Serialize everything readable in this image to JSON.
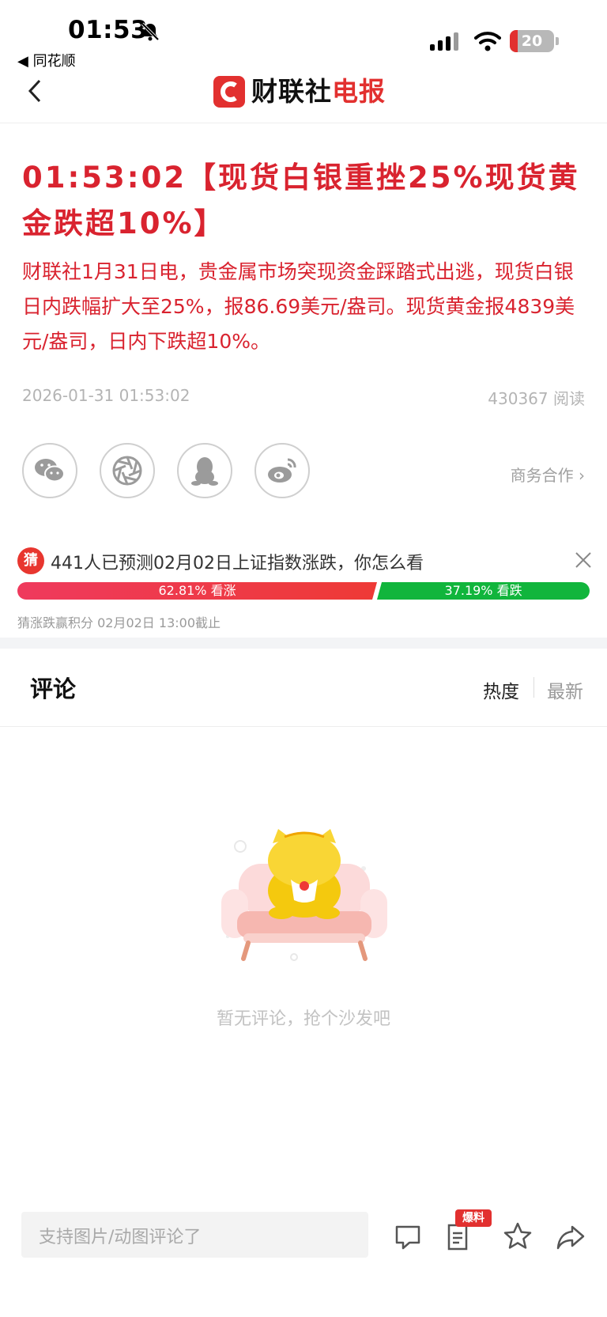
{
  "status_bar": {
    "time": "01:53",
    "back_app": "◀ 同花顺",
    "battery": "20"
  },
  "nav": {
    "logo_black": "财联社",
    "logo_red": "电报"
  },
  "article": {
    "headline": "01:53:02【现货白银重挫25%现货黄金跌超10%】",
    "body": "财联社1月31日电，贵金属市场突现资金踩踏式出逃，现货白银日内跌幅扩大至25%，报86.69美元/盎司。现货黄金报4839美元/盎司，日内下跌超10%。",
    "datetime": "2026-01-31 01:53:02",
    "reads": "430367 阅读",
    "business": "商务合作 ›"
  },
  "share_icons": [
    "wechat-icon",
    "moments-icon",
    "qq-icon",
    "weibo-icon"
  ],
  "poll": {
    "badge": "猜",
    "question": "441人已预测02月02日上证指数涨跌，你怎么看",
    "up_label": "62.81% 看涨",
    "down_label": "37.19% 看跌",
    "up_fraction": 0.6281,
    "down_fraction": 0.3719,
    "footer": "猜涨跌赢积分   02月02日 13:00截止"
  },
  "comments": {
    "title": "评论",
    "sort_hot": "热度",
    "sort_new": "最新",
    "empty_text": "暂无评论，抢个沙发吧"
  },
  "bottom_bar": {
    "placeholder": "支持图片/动图评论了",
    "baoliao": "爆料",
    "icons": [
      "comment-icon",
      "report-icon",
      "star-icon",
      "share-icon"
    ]
  },
  "colors": {
    "accent": "#d9232f",
    "up": "#ee3a36",
    "down": "#11b53c"
  }
}
